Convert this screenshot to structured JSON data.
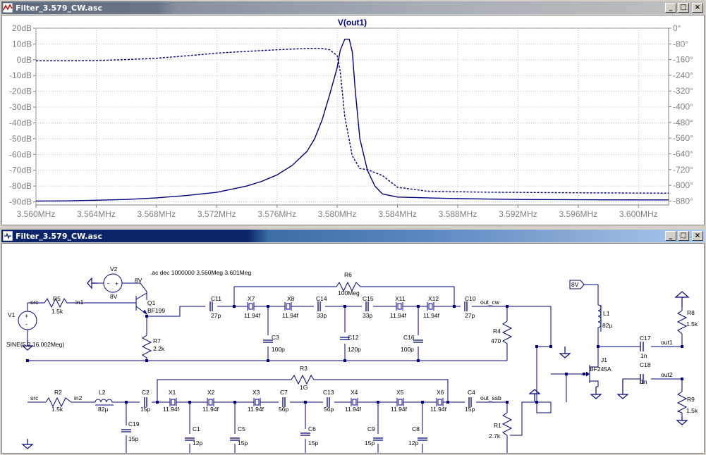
{
  "waveform_window": {
    "title": "Filter_3.579_CW.asc",
    "trace_label": "V(out1)",
    "y_left_ticks": [
      "20dB",
      "10dB",
      "0dB",
      "-10dB",
      "-20dB",
      "-30dB",
      "-40dB",
      "-50dB",
      "-60dB",
      "-70dB",
      "-80dB",
      "-90dB"
    ],
    "y_right_ticks": [
      "0°",
      "-80°",
      "-160°",
      "-240°",
      "-320°",
      "-400°",
      "-480°",
      "-560°",
      "-640°",
      "-720°",
      "-800°",
      "-880°"
    ],
    "x_ticks": [
      "3.560MHz",
      "3.564MHz",
      "3.568MHz",
      "3.572MHz",
      "3.576MHz",
      "3.580MHz",
      "3.584MHz",
      "3.588MHz",
      "3.592MHz",
      "3.596MHz",
      "3.600MHz"
    ]
  },
  "chart_data": {
    "type": "line",
    "title": "V(out1)",
    "xlim": [
      3.56,
      3.602
    ],
    "ylim": [
      -92,
      20
    ],
    "y2lim": [
      -900,
      0
    ],
    "grid": true,
    "series": [
      {
        "name": "V(out1)",
        "style": "solid",
        "color": "#000080",
        "x": [
          3.56,
          3.562,
          3.564,
          3.566,
          3.568,
          3.57,
          3.572,
          3.574,
          3.575,
          3.576,
          3.577,
          3.578,
          3.5785,
          3.579,
          3.5795,
          3.58,
          3.5802,
          3.5805,
          3.5808,
          3.581,
          3.5812,
          3.5815,
          3.582,
          3.5825,
          3.583,
          3.584,
          3.586,
          3.588,
          3.592,
          3.596,
          3.6,
          3.602
        ],
        "y": [
          -89.5,
          -89.4,
          -89,
          -88.5,
          -87.5,
          -86,
          -84,
          -80,
          -77,
          -73,
          -67,
          -58,
          -50,
          -38,
          -22,
          -5,
          6,
          13,
          13,
          5,
          -20,
          -50,
          -70,
          -80,
          -85,
          -87,
          -87.5,
          -88,
          -88.5,
          -88.7,
          -88.8,
          -88.8
        ]
      },
      {
        "name": "phase",
        "style": "dashed",
        "color": "#000080",
        "axis": "right",
        "x": [
          3.56,
          3.562,
          3.564,
          3.566,
          3.568,
          3.57,
          3.572,
          3.574,
          3.576,
          3.578,
          3.579,
          3.5795,
          3.58,
          3.5802,
          3.5805,
          3.581,
          3.5815,
          3.582,
          3.583,
          3.584,
          3.586,
          3.59,
          3.596,
          3.602
        ],
        "y": [
          -166,
          -166,
          -165,
          -160,
          -153,
          -141,
          -127,
          -118,
          -110,
          -103,
          -103,
          -110,
          -140,
          -220,
          -450,
          -650,
          -715,
          -720,
          -750,
          -810,
          -830,
          -835,
          -838,
          -840
        ]
      }
    ]
  },
  "schematic_window": {
    "title": "Filter_3.579_CW.asc",
    "directive": ".ac dec 1000000 3.560Meg 3.601Meg",
    "labels": {
      "V2": "V2",
      "V2_val": "8V",
      "Q1_supply": "8V",
      "Q1": "Q1",
      "Q1_model": "BF199",
      "src1": "src",
      "R5": "R5",
      "R5_val": "1.5k",
      "in1": "in1",
      "V1": "V1",
      "V1_val": "SINE(5.2 16.002Meg)",
      "R7": "R7",
      "R7_val": "2.2k",
      "R6": "R6",
      "R6_val": "100Meg",
      "C11": "C11",
      "C11_val": "27p",
      "X7": "X7",
      "X7_val": "11.94f",
      "X8": "X8",
      "X8_val": "11.94f",
      "C14": "C14",
      "C14_val": "33p",
      "C15": "C15",
      "C15_val": "33p",
      "X11": "X11",
      "X11_val": "11.94f",
      "X12": "X12",
      "X12_val": "11.94f",
      "C10": "C10",
      "C10_val": "27p",
      "out_cw": "out_cw",
      "C3": "C3",
      "C3_val": "100p",
      "C12": "C12",
      "C12_val": "120p",
      "C16": "C16",
      "C16_val": "100p",
      "R4": "R4",
      "R4_val": "470",
      "R3": "R3",
      "R3_val": "1G",
      "src2": "src",
      "R2": "R2",
      "R2_val": "1.5k",
      "in2": "in2",
      "L2": "L2",
      "L2_val": "82µ",
      "C2": "C2",
      "C2_val": "15p",
      "X1": "X1",
      "X1_val": "11.94f",
      "X2": "X2",
      "X2_val": "11.94f",
      "X3": "X3",
      "X3_val": "11.94f",
      "C7": "C7",
      "C7_val": "56p",
      "C13": "C13",
      "C13_val": "56p",
      "X4": "X4",
      "X4_val": "11.94f",
      "X5": "X5",
      "X5_val": "11.94f",
      "X6": "X6",
      "X6_val": "11.94f",
      "C4": "C4",
      "C4_val": "15p",
      "out_ssb": "out_ssb",
      "C19": "C19",
      "C19_val": "15p",
      "C1": "C1",
      "C1_val": "12p",
      "C5": "C5",
      "C5_val": "15p",
      "C6": "C6",
      "C6_val": "15p",
      "C9": "C9",
      "C9_val": "15p",
      "C8": "C8",
      "C8_val": "12p",
      "R1": "R1",
      "R1_val": "2.7k",
      "J1_supply": "8V",
      "L1": "L1",
      "L1_val": "82µ",
      "J1": "J1",
      "J1_model": "BF245A",
      "C17": "C17",
      "C17_val": "1n",
      "out1": "out1",
      "C18": "C18",
      "C18_val": "1n",
      "out2": "out2",
      "R8": "R8",
      "R8_val": "1.5k",
      "R9": "R9",
      "R9_val": "1.5k"
    }
  },
  "window_buttons": {
    "minimize": "_",
    "maximize": "□",
    "close": "×"
  }
}
